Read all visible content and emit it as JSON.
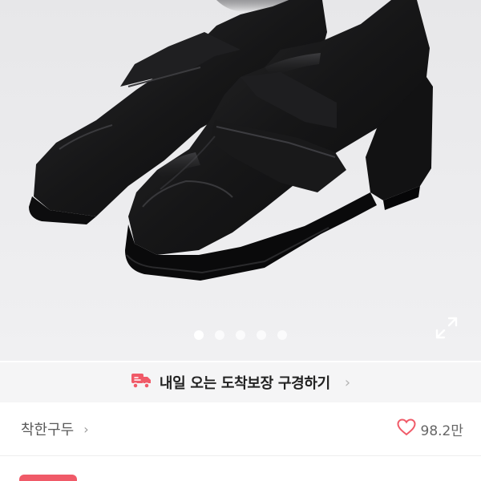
{
  "gallery": {
    "image_alt": "검정 로퍼 힐 구두",
    "dots_total": 5,
    "active_index": 0,
    "expand_icon": "expand-icon"
  },
  "banner": {
    "icon": "delivery-truck-icon",
    "text": "내일 오는 도착보장 구경하기",
    "chevron": "›",
    "accent_color": "#f05a68"
  },
  "shop": {
    "name": "착한구두",
    "chevron": "›"
  },
  "likes": {
    "icon": "heart-icon",
    "count": "98.2만",
    "icon_color": "#f05a68"
  },
  "badge": {
    "color": "#f05a68"
  }
}
